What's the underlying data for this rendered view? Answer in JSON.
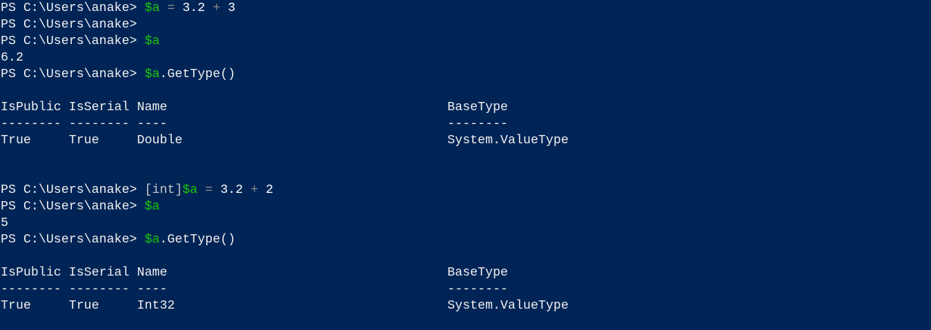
{
  "window": {
    "app": "Windows PowerShell",
    "background": "#012456"
  },
  "colors": {
    "text": "#f0f0f0",
    "variable": "#16c60c",
    "operator": "#8a8a8a",
    "type": "#c8c8c8"
  },
  "lines": [
    [
      {
        "t": "PS C:\\Users\\anake> ",
        "c": "text"
      },
      {
        "t": "$a",
        "c": "var"
      },
      {
        "t": " = ",
        "c": "op"
      },
      {
        "t": "3.2",
        "c": "num"
      },
      {
        "t": " + ",
        "c": "op"
      },
      {
        "t": "3",
        "c": "num"
      }
    ],
    [
      {
        "t": "PS C:\\Users\\anake>",
        "c": "text"
      }
    ],
    [
      {
        "t": "PS C:\\Users\\anake> ",
        "c": "text"
      },
      {
        "t": "$a",
        "c": "var"
      }
    ],
    [
      {
        "t": "6.2",
        "c": "text"
      }
    ],
    [
      {
        "t": "PS C:\\Users\\anake> ",
        "c": "text"
      },
      {
        "t": "$a",
        "c": "var"
      },
      {
        "t": ".GetType()",
        "c": "text"
      }
    ],
    [],
    [
      {
        "t": "IsPublic IsSerial Name                                     BaseType",
        "c": "text"
      }
    ],
    [
      {
        "t": "-------- -------- ----                                     --------",
        "c": "text"
      }
    ],
    [
      {
        "t": "True     True     Double                                   System.ValueType",
        "c": "text"
      }
    ],
    [],
    [],
    [
      {
        "t": "PS C:\\Users\\anake> ",
        "c": "text"
      },
      {
        "t": "[int]",
        "c": "type"
      },
      {
        "t": "$a",
        "c": "var"
      },
      {
        "t": " = ",
        "c": "op"
      },
      {
        "t": "3.2",
        "c": "num"
      },
      {
        "t": " + ",
        "c": "op"
      },
      {
        "t": "2",
        "c": "num"
      }
    ],
    [
      {
        "t": "PS C:\\Users\\anake> ",
        "c": "text"
      },
      {
        "t": "$a",
        "c": "var"
      }
    ],
    [
      {
        "t": "5",
        "c": "text"
      }
    ],
    [
      {
        "t": "PS C:\\Users\\anake> ",
        "c": "text"
      },
      {
        "t": "$a",
        "c": "var"
      },
      {
        "t": ".GetType()",
        "c": "text"
      }
    ],
    [],
    [
      {
        "t": "IsPublic IsSerial Name                                     BaseType",
        "c": "text"
      }
    ],
    [
      {
        "t": "-------- -------- ----                                     --------",
        "c": "text"
      }
    ],
    [
      {
        "t": "True     True     Int32                                    System.ValueType",
        "c": "text"
      }
    ]
  ]
}
